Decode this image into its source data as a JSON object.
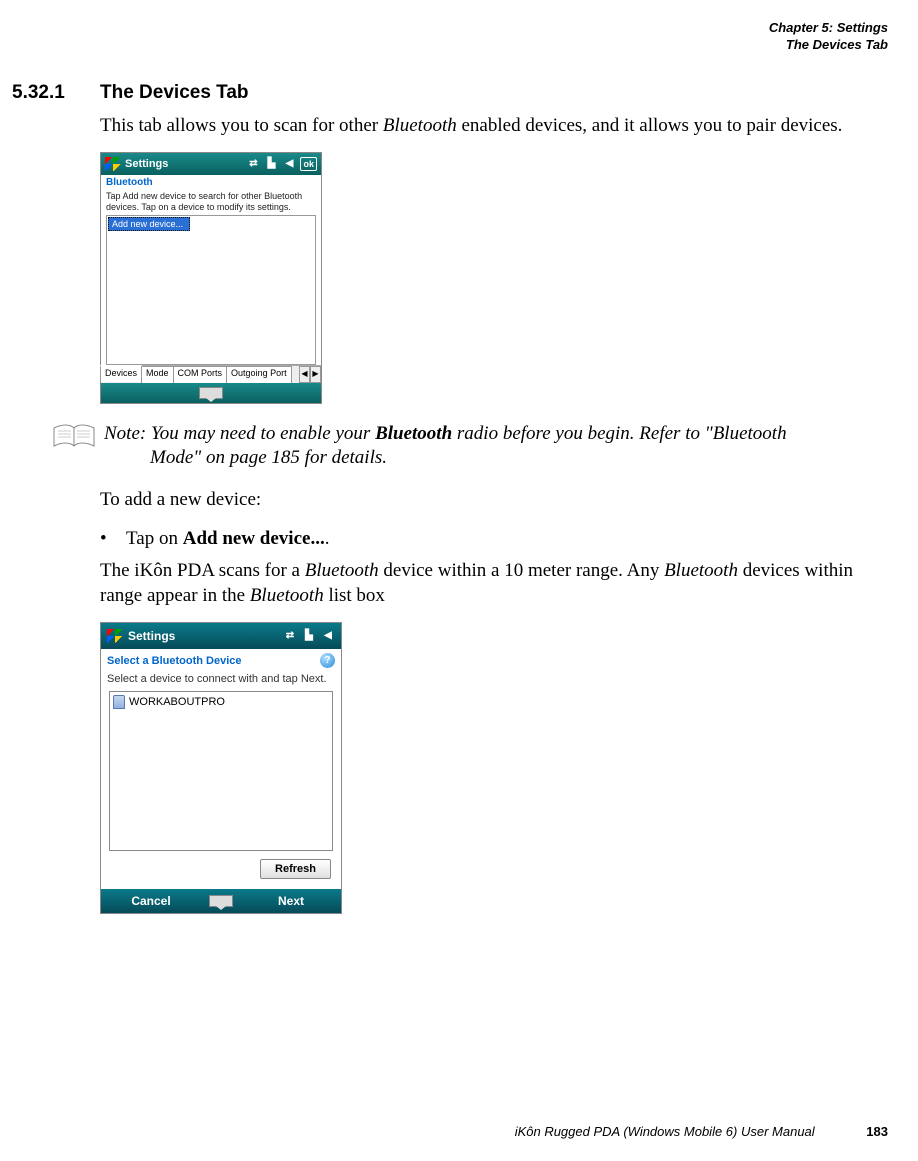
{
  "header": {
    "chapter": "Chapter 5:  Settings",
    "section": "The Devices Tab"
  },
  "section": {
    "number": "5.32.1",
    "title": "The Devices Tab"
  },
  "intro": {
    "pre": "This tab allows you to scan for other ",
    "bt": "Bluetooth",
    "post": " enabled devices, and it allows you to pair devices."
  },
  "shot1": {
    "title": "Settings",
    "ok": "ok",
    "subtitle": "Bluetooth",
    "instruction": "Tap Add new device to search for other Bluetooth devices. Tap on a device to modify its settings.",
    "selected": "Add new device...",
    "tabs": [
      "Devices",
      "Mode",
      "COM Ports",
      "Outgoing Port"
    ]
  },
  "note": {
    "lead": "Note: You may need to enable your ",
    "bold": "Bluetooth",
    "rest1": " radio before you begin. Refer to \"Bluetooth ",
    "rest2": "Mode\" on page 185 for details."
  },
  "add_intro": "To add a new device:",
  "bullet": {
    "pre": "Tap on ",
    "bold": "Add new device...",
    "post": "."
  },
  "scan": {
    "pre": "The iKôn PDA scans for a ",
    "bt1": "Bluetooth",
    "mid": " device within a 10 meter range. Any ",
    "bt2": "Bluetooth",
    "mid2": " devices within range appear in the ",
    "bt3": "Bluetooth",
    "post": " list box"
  },
  "shot2": {
    "title": "Settings",
    "subtitle": "Select a Bluetooth Device",
    "instruction": "Select a device to connect with and tap Next.",
    "device": "WORKABOUTPRO",
    "refresh": "Refresh",
    "cancel": "Cancel",
    "next": "Next"
  },
  "footer": {
    "text": "iKôn Rugged PDA (Windows Mobile 6) User Manual",
    "page": "183"
  }
}
